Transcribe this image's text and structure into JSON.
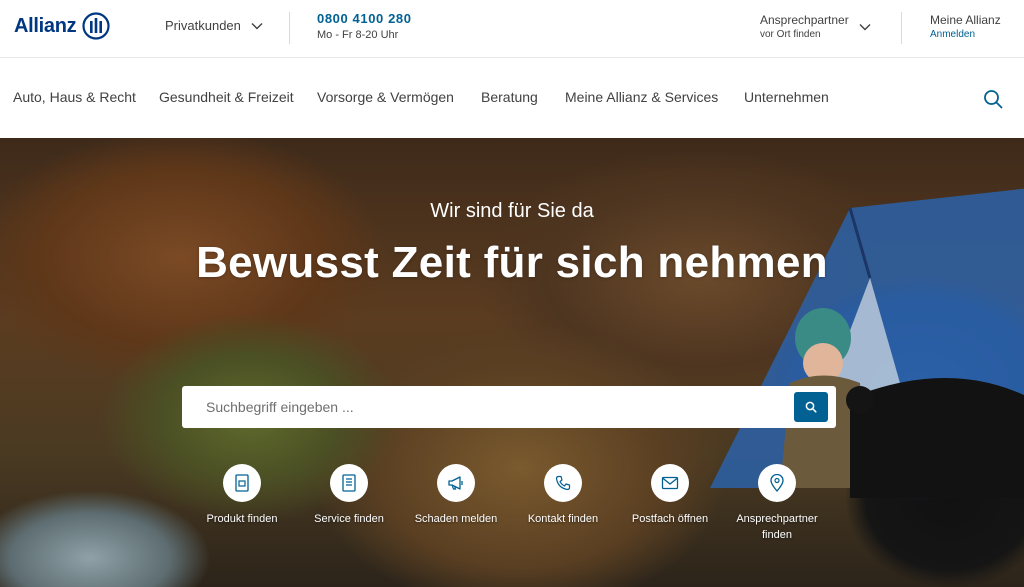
{
  "brand": {
    "name": "Allianz",
    "color": "#003781"
  },
  "topbar": {
    "segment_label": "Privatkunden",
    "phone_number": "0800 4100 280",
    "phone_hours": "Mo - Fr 8-20 Uhr",
    "contact_title": "Ansprechpartner",
    "contact_sub": "vor Ort finden",
    "account_title": "Meine Allianz",
    "account_login": "Anmelden"
  },
  "nav": {
    "items": [
      {
        "label": "Auto, Haus & Recht"
      },
      {
        "label": "Gesundheit & Freizeit"
      },
      {
        "label": "Vorsorge & Vermögen"
      },
      {
        "label": "Beratung"
      },
      {
        "label": "Meine Allianz & Services"
      },
      {
        "label": "Unternehmen"
      }
    ],
    "search_icon": "search-icon"
  },
  "hero": {
    "kicker": "Wir sind für Sie da",
    "title": "Bewusst Zeit für sich nehmen",
    "search": {
      "placeholder": "Suchbegriff eingeben ...",
      "value": ""
    },
    "quick_actions": [
      {
        "label": "Produkt finden",
        "icon": "document-icon"
      },
      {
        "label": "Service finden",
        "icon": "form-icon"
      },
      {
        "label": "Schaden melden",
        "icon": "megaphone-icon"
      },
      {
        "label": "Kontakt finden",
        "icon": "phone-icon"
      },
      {
        "label": "Postfach öffnen",
        "icon": "mail-icon"
      },
      {
        "label": "Ansprechpartner finden",
        "icon": "location-pin-icon"
      }
    ]
  },
  "colors": {
    "accent": "#006192",
    "text": "#414141",
    "brand": "#003781"
  }
}
